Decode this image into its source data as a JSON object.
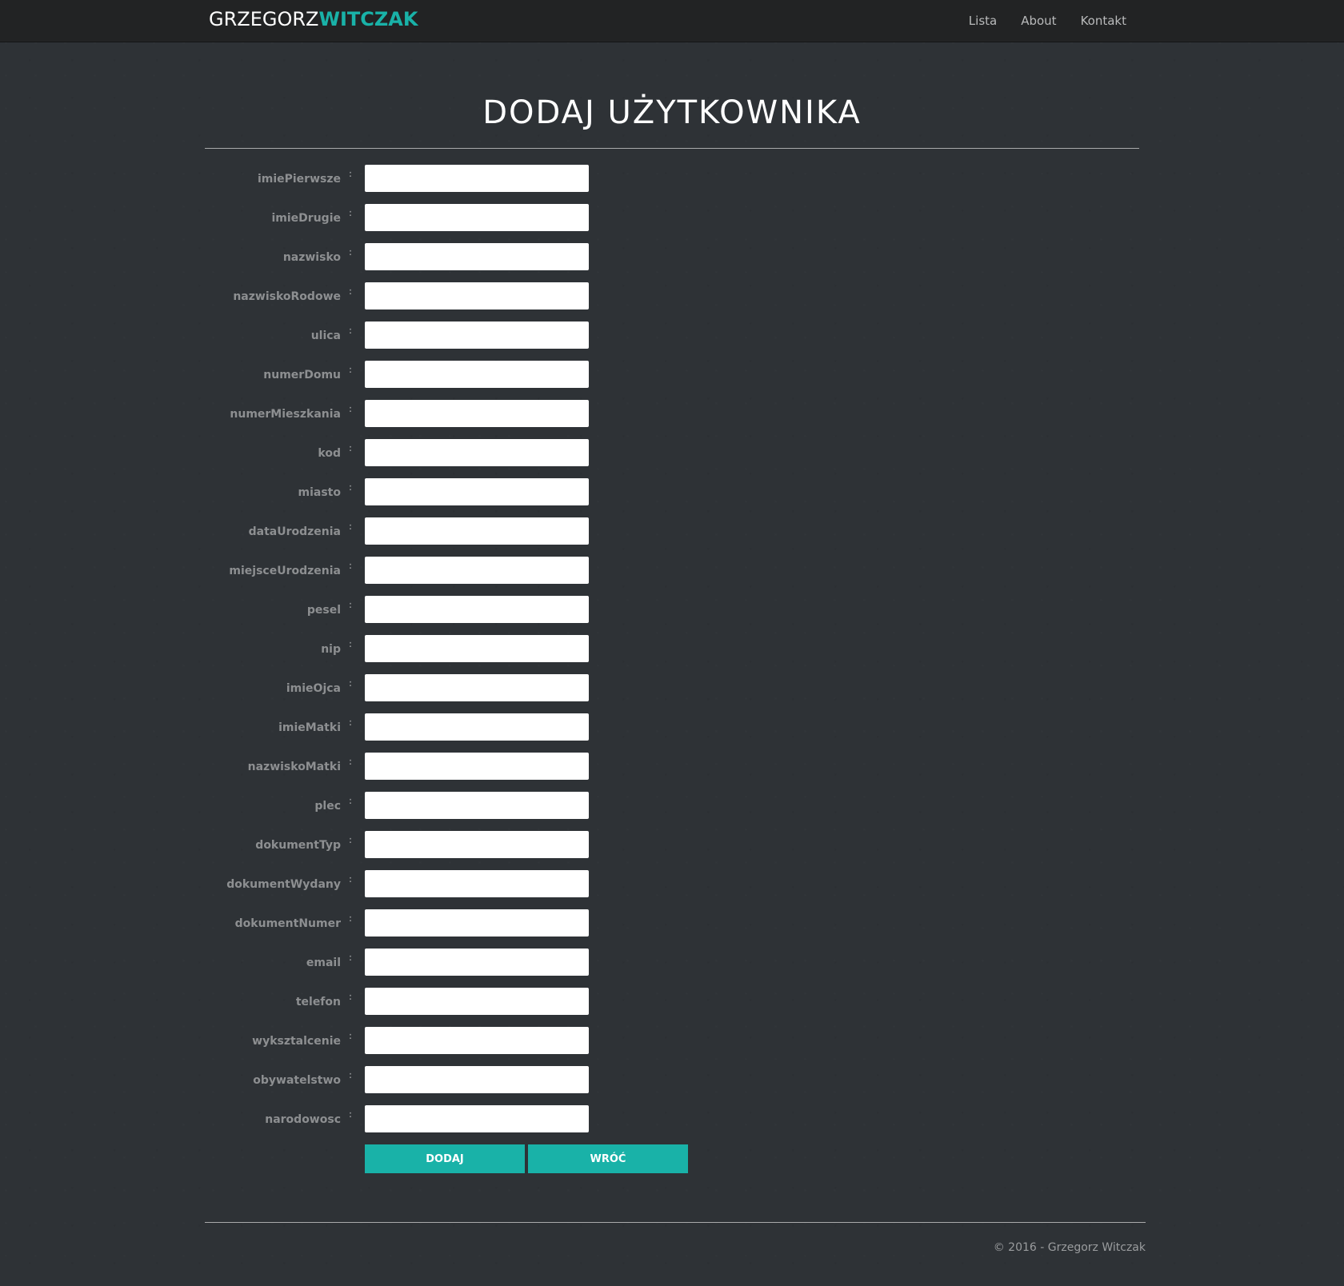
{
  "brand": {
    "first": "GRZEGORZ",
    "last": "WITCZAK"
  },
  "nav": {
    "items": [
      "Lista",
      "About",
      "Kontakt"
    ]
  },
  "page": {
    "title": "DODAJ UŻYTKOWNIKA"
  },
  "form": {
    "colon": ":",
    "fields": [
      {
        "label": "imiePierwsze",
        "value": ""
      },
      {
        "label": "imieDrugie",
        "value": ""
      },
      {
        "label": "nazwisko",
        "value": ""
      },
      {
        "label": "nazwiskoRodowe",
        "value": ""
      },
      {
        "label": "ulica",
        "value": ""
      },
      {
        "label": "numerDomu",
        "value": ""
      },
      {
        "label": "numerMieszkania",
        "value": ""
      },
      {
        "label": "kod",
        "value": ""
      },
      {
        "label": "miasto",
        "value": ""
      },
      {
        "label": "dataUrodzenia",
        "value": ""
      },
      {
        "label": "miejsceUrodzenia",
        "value": ""
      },
      {
        "label": "pesel",
        "value": ""
      },
      {
        "label": "nip",
        "value": ""
      },
      {
        "label": "imieOjca",
        "value": ""
      },
      {
        "label": "imieMatki",
        "value": ""
      },
      {
        "label": "nazwiskoMatki",
        "value": ""
      },
      {
        "label": "plec",
        "value": ""
      },
      {
        "label": "dokumentTyp",
        "value": ""
      },
      {
        "label": "dokumentWydany",
        "value": ""
      },
      {
        "label": "dokumentNumer",
        "value": ""
      },
      {
        "label": "email",
        "value": ""
      },
      {
        "label": "telefon",
        "value": ""
      },
      {
        "label": "wyksztalcenie",
        "value": ""
      },
      {
        "label": "obywatelstwo",
        "value": ""
      },
      {
        "label": "narodowosc",
        "value": ""
      }
    ],
    "submit_label": "DODAJ",
    "back_label": "WRÓĆ"
  },
  "footer": {
    "text": "© 2016 - Grzegorz Witczak"
  },
  "colors": {
    "accent": "#19b2a8",
    "background": "#2e3236",
    "navbar": "#222324"
  }
}
